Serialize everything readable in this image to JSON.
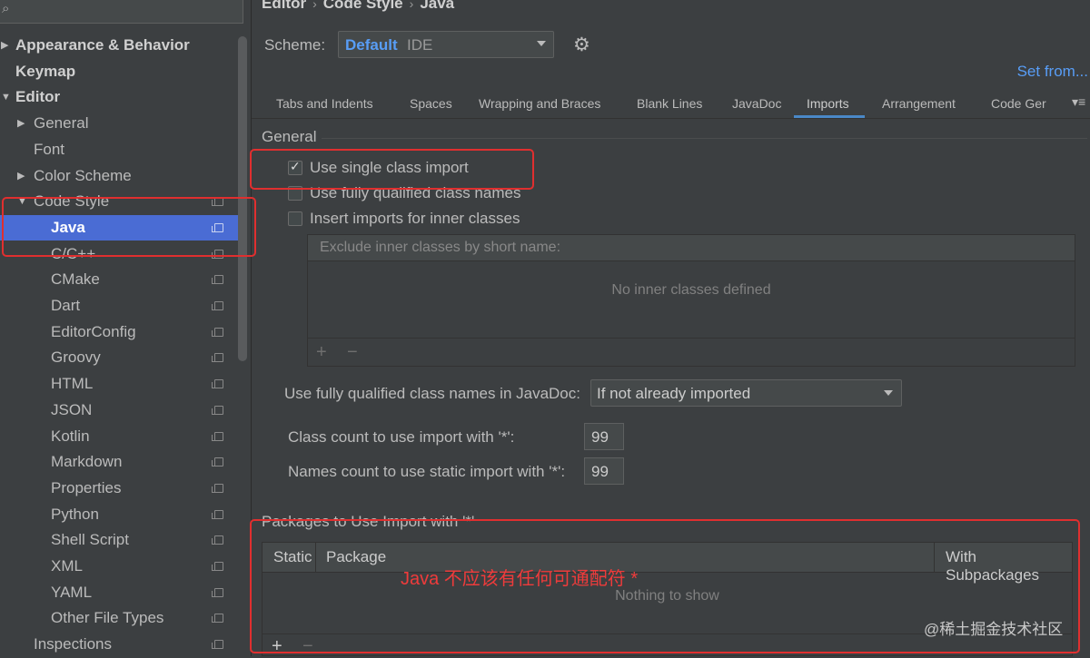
{
  "sidebar": {
    "search_icon": "search-icon",
    "items": [
      {
        "label": "Appearance & Behavior",
        "arrow": "▶",
        "level": 0
      },
      {
        "label": "Keymap",
        "arrow": "",
        "level": 0
      },
      {
        "label": "Editor",
        "arrow": "▼",
        "level": 0
      },
      {
        "label": "General",
        "arrow": "▶",
        "level": 1
      },
      {
        "label": "Font",
        "arrow": "",
        "level": 1
      },
      {
        "label": "Color Scheme",
        "arrow": "▶",
        "level": 1
      },
      {
        "label": "Code Style",
        "arrow": "▼",
        "level": 1
      },
      {
        "label": "Java",
        "arrow": "",
        "level": 2
      },
      {
        "label": "C/C++",
        "arrow": "",
        "level": 2
      },
      {
        "label": "CMake",
        "arrow": "",
        "level": 2
      },
      {
        "label": "Dart",
        "arrow": "",
        "level": 2
      },
      {
        "label": "EditorConfig",
        "arrow": "",
        "level": 2
      },
      {
        "label": "Groovy",
        "arrow": "",
        "level": 2
      },
      {
        "label": "HTML",
        "arrow": "",
        "level": 2
      },
      {
        "label": "JSON",
        "arrow": "",
        "level": 2
      },
      {
        "label": "Kotlin",
        "arrow": "",
        "level": 2
      },
      {
        "label": "Markdown",
        "arrow": "",
        "level": 2
      },
      {
        "label": "Properties",
        "arrow": "",
        "level": 2
      },
      {
        "label": "Python",
        "arrow": "",
        "level": 2
      },
      {
        "label": "Shell Script",
        "arrow": "",
        "level": 2
      },
      {
        "label": "XML",
        "arrow": "",
        "level": 2
      },
      {
        "label": "YAML",
        "arrow": "",
        "level": 2
      },
      {
        "label": "Other File Types",
        "arrow": "",
        "level": 2
      },
      {
        "label": "Inspections",
        "arrow": "",
        "level": 1
      }
    ],
    "selected": "Java"
  },
  "breadcrumb": [
    "Editor",
    "Code Style",
    "Java"
  ],
  "breadcrumb_sep": "›",
  "scheme": {
    "label": "Scheme:",
    "value": "Default",
    "sub": "IDE"
  },
  "set_from": "Set from...",
  "tabs": [
    "Tabs and Indents",
    "Spaces",
    "Wrapping and Braces",
    "Blank Lines",
    "JavaDoc",
    "Imports",
    "Arrangement",
    "Code Ger"
  ],
  "active_tab": "Imports",
  "general": {
    "title": "General",
    "options": [
      {
        "label": "Use single class import",
        "checked": true
      },
      {
        "label": "Use fully qualified class names",
        "checked": false
      },
      {
        "label": "Insert imports for inner classes",
        "checked": false
      }
    ],
    "exclude_title": "Exclude inner classes by short name:",
    "exclude_empty": "No inner classes defined",
    "add": "+",
    "remove": "−"
  },
  "javadoc": {
    "label": "Use fully qualified class names in JavaDoc:",
    "value": "If not already imported"
  },
  "class_count": {
    "label": "Class count to use import with '*':",
    "value": "99"
  },
  "names_count": {
    "label": "Names count to use static import with '*':",
    "value": "99"
  },
  "packages": {
    "title": "Packages to Use Import with '*'",
    "columns": [
      "Static",
      "Package",
      "With Subpackages"
    ],
    "empty": "Nothing to show",
    "add": "+",
    "remove": "−"
  },
  "annotation": "Java 不应该有任何可通配符 *",
  "watermark": "@稀土掘金技术社区",
  "colors": {
    "accent": "#589df6",
    "selection": "#4a6cd4",
    "annotation_red": "#e02f2f",
    "background": "#3c3f41"
  }
}
